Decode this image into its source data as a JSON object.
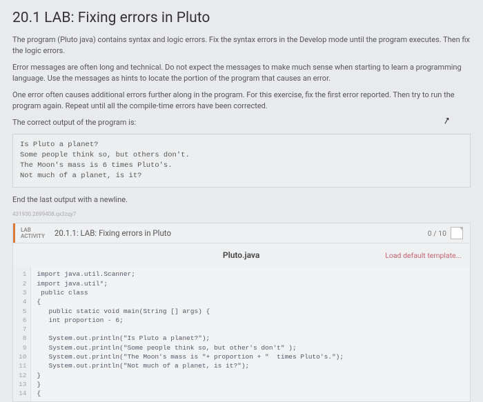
{
  "title": "20.1 LAB: Fixing errors in Pluto",
  "paragraphs": {
    "p1": "The program (Pluto java) contains syntax and logic errors. Fix the syntax errors in the Develop mode until the program executes. Then fix the logic errors.",
    "p2": "Error messages are often long and technical. Do not expect the messages to make much sense when starting to learn a programming language. Use the messages as hints to locate the portion of the program that causes an error.",
    "p3": "One error often causes additional errors further along in the program. For this exercise, fix the first error reported. Then try to run the program again. Repeat until all the compile-time errors have been corrected.",
    "p4": "The correct output of the program is:"
  },
  "expected_output": "Is Pluto a planet?\nSome people think so, but others don't.\nThe Moon's mass is 6 times Pluto's.\nNot much of a planet, is it?",
  "after_output": "End the last output with a newline.",
  "tiny_gray": "431930.2899408.qx3zqy7",
  "lab": {
    "tag1": "LAB",
    "tag2": "ACTIVITY",
    "title": "20.1.1: LAB: Fixing errors in Pluto",
    "score": "0 / 10"
  },
  "filebar": {
    "filename": "Pluto.java",
    "load": "Load default template..."
  },
  "code": {
    "gutter": [
      "1",
      "2",
      "3",
      "4",
      "5",
      "6",
      "7",
      "8",
      "9",
      "10",
      "11",
      "12",
      "13",
      "14"
    ],
    "text": "import java.util.Scanner;\nimport java.util*;\n public class\n{\n   public static void main(String [] args) {\n   int proportion - 6;\n\n   System.out.println(\"Is Pluto a planet?\");\n   System.out.println(\"Some people think so, but other's don't\" );\n   System.out.println(\"The Moon's mass is \"+ proportion + \"  times Pluto's.\");\n   System.out.println(\"Not much of a planet, is it?\");\n}\n}\n{"
  }
}
